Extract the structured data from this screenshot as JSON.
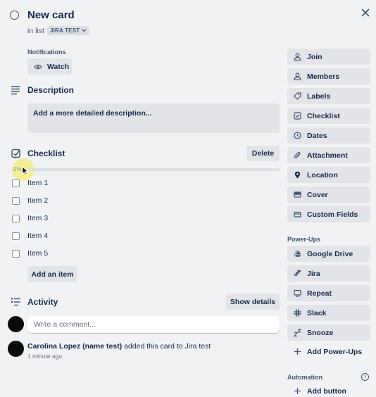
{
  "card": {
    "title": "New card",
    "in_list_prefix": "in list",
    "list_name": "JIRA TEST"
  },
  "notifications": {
    "label": "Notifications",
    "watch_label": "Watch"
  },
  "description": {
    "title": "Description",
    "placeholder": "Add a more detailed description..."
  },
  "checklist": {
    "title": "Checklist",
    "delete_label": "Delete",
    "progress": "0%",
    "progress_fraction": 0,
    "items": [
      {
        "label": "Item 1",
        "checked": false
      },
      {
        "label": "Item 2",
        "checked": false
      },
      {
        "label": "Item 3",
        "checked": false
      },
      {
        "label": "Item 4",
        "checked": false
      },
      {
        "label": "Item 5",
        "checked": false
      }
    ],
    "add_item_label": "Add an item"
  },
  "activity": {
    "title": "Activity",
    "show_details_label": "Show details",
    "comment_placeholder": "Write a comment...",
    "entries": [
      {
        "user": "Carolina Lopez (name test)",
        "action": " added this card to Jira test",
        "time": "1 minute ago"
      }
    ]
  },
  "sidebar": {
    "actions": [
      {
        "label": "Join",
        "icon": "user-icon"
      },
      {
        "label": "Members",
        "icon": "members-icon"
      },
      {
        "label": "Labels",
        "icon": "label-tag-icon"
      },
      {
        "label": "Checklist",
        "icon": "checklist-icon"
      },
      {
        "label": "Dates",
        "icon": "clock-icon"
      },
      {
        "label": "Attachment",
        "icon": "paperclip-icon"
      },
      {
        "label": "Location",
        "icon": "location-pin-icon"
      },
      {
        "label": "Cover",
        "icon": "cover-icon"
      },
      {
        "label": "Custom Fields",
        "icon": "custom-fields-icon"
      }
    ],
    "power_ups_label": "Power-Ups",
    "power_ups": [
      {
        "label": "Google Drive",
        "icon": "google-drive-icon"
      },
      {
        "label": "Jira",
        "icon": "jira-icon"
      },
      {
        "label": "Repeat",
        "icon": "repeat-icon"
      },
      {
        "label": "Slack",
        "icon": "slack-icon"
      },
      {
        "label": "Snooze",
        "icon": "snooze-icon"
      }
    ],
    "add_power_ups_label": "Add Power-Ups",
    "automation_label": "Automation",
    "add_button_label": "Add button"
  },
  "colors": {
    "background": "#f1f2f4",
    "button": "#e2e4e8",
    "text": "#172b4d",
    "subtle_text": "#44546f",
    "cursor_highlight": "#f5ee6e"
  }
}
